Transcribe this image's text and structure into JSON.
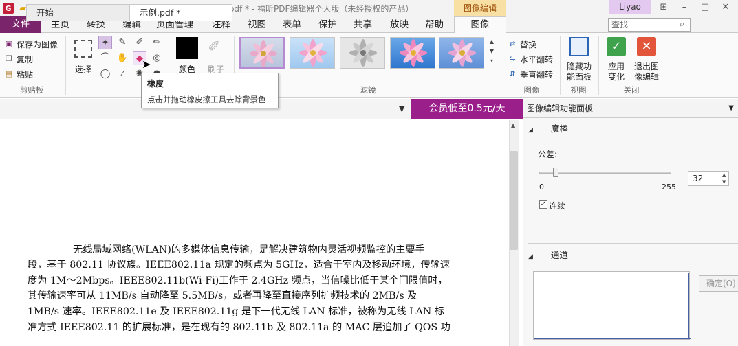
{
  "window": {
    "title": "示例.pdf * - 福昕PDF编辑器个人版（未经授权的产品）",
    "context_tab_group": "图像编辑",
    "user": "Liyao"
  },
  "menu": {
    "file": "文件",
    "items": [
      "主页",
      "转换",
      "编辑",
      "页面管理",
      "注释",
      "视图",
      "表单",
      "保护",
      "共享",
      "放映",
      "帮助"
    ],
    "active_tab": "图像",
    "search_placeholder": "查找"
  },
  "ribbon": {
    "clipboard": {
      "label": "剪贴板",
      "save_as_image": "保存为图像",
      "copy": "复制",
      "paste": "粘贴"
    },
    "select_label": "选择",
    "color_label": "颜色",
    "brush_label": "刷子",
    "filter_label": "滤镜",
    "image_group": {
      "label": "图像",
      "replace": "替换",
      "flip_h": "水平翻转",
      "flip_v": "垂直翻转"
    },
    "view_group": {
      "label": "视图",
      "hide_panel_l1": "隐藏功",
      "hide_panel_l2": "能面板"
    },
    "close_group": {
      "label": "关闭",
      "apply_l1": "应用",
      "apply_l2": "变化",
      "exit_l1": "退出图",
      "exit_l2": "像编辑"
    }
  },
  "tooltip": {
    "title": "橡皮",
    "desc": "点击并拖动橡皮擦工具去除背景色"
  },
  "tabs": {
    "start": "开始",
    "doc": "示例.pdf *",
    "promo": "会员低至0.5元/天"
  },
  "document": {
    "lines": [
      "无线局域网络(WLAN)的多媒体信息传输，是解决建筑物内灵活视频监控的主要手",
      "段，基于 802.11 协议族。IEEE802.11a 规定的频点为 5GHz，适合于室内及移动环境，传输速",
      "度为 1M～2Mbps。IEEE802.11b(Wi-Fi)工作于 2.4GHz 频点，当信噪比低于某个门限值时，",
      "其传输速率可从 11MB/s 自动降至 5.5MB/s，或者再降至直接序列扩频技术的 2MB/s 及",
      "1MB/s 速率。IEEE802.11e 及 IEEE802.11g 是下一代无线 LAN 标准，被称为无线 LAN 标",
      "准方式 IEEE802.11 的扩展标准，是在现有的 802.11b 及 802.11a 的 MAC 层追加了 QOS 功"
    ]
  },
  "panel": {
    "title": "图像编辑功能面板",
    "magic_wand": "魔棒",
    "tolerance_label": "公差:",
    "slider_min": "0",
    "slider_max": "255",
    "tolerance_value": "32",
    "tolerance_fraction": 0.125,
    "contiguous": "连续",
    "contiguous_checked": true,
    "channel": "通道",
    "ok_button": "确定(O)"
  },
  "colors": {
    "accent": "#7a246c",
    "promo": "#9a1f8a",
    "context_tab": "#f8dfa4",
    "user_badge": "#e3c9ef"
  }
}
